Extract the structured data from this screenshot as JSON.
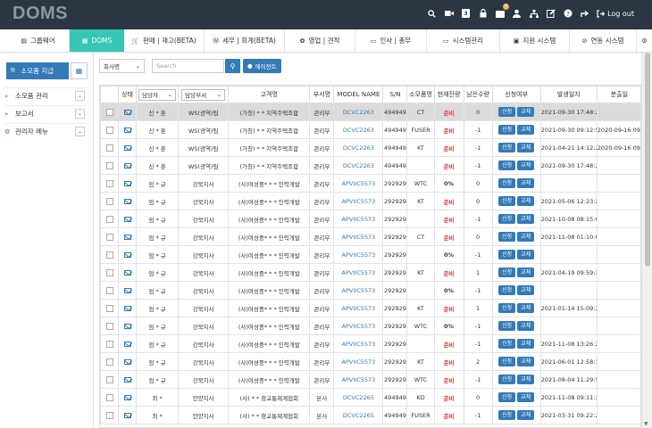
{
  "app": {
    "logo": "DOMS",
    "logout_label": "Log out",
    "notification_count": "0",
    "mail_count": "3"
  },
  "nav": {
    "tabs": [
      {
        "icon": "grid-icon",
        "glyph": "▤",
        "label": "그룹웨어"
      },
      {
        "icon": "grid-icon",
        "glyph": "▦",
        "label": "DOMS"
      },
      {
        "icon": "cart-icon",
        "glyph": "🛒",
        "label": "판매 | 재고(BETA)"
      },
      {
        "icon": "won-icon",
        "glyph": "Ⓦ",
        "label": "세무 | 회계(BETA)"
      },
      {
        "icon": "handshake-icon",
        "glyph": "✿",
        "label": "영업 | 견적"
      },
      {
        "icon": "person-card-icon",
        "glyph": "▭",
        "label": "인사 | 총무"
      },
      {
        "icon": "monitor-icon",
        "glyph": "▭",
        "label": "시스템관리"
      },
      {
        "icon": "briefcase-icon",
        "glyph": "▣",
        "label": "지원 시스템"
      },
      {
        "icon": "link-icon",
        "glyph": "⊘",
        "label": "연동 시스템"
      }
    ]
  },
  "sidebar": {
    "title": "소모품 지급",
    "items": [
      {
        "label": "소모품 관리"
      },
      {
        "label": "보고서"
      },
      {
        "label": "관리자 메뉴"
      }
    ]
  },
  "filter": {
    "select_value": "회사명",
    "search_placeholder": "Search",
    "agent_button": "에이전트"
  },
  "table": {
    "headers": {
      "status": "상태",
      "manager_select": "담당자",
      "dept_select": "담당부서",
      "customer": "고객명",
      "dept": "부서명",
      "model": "MODEL NAME",
      "sn": "S/N",
      "item": "소모품명",
      "toner": "현재잔량",
      "remain": "남은수량",
      "apply_status": "신청여부",
      "date": "발생일지",
      "split": "분출일"
    },
    "apply_label": "신청",
    "replace_label": "교체",
    "rows": [
      {
        "manager": "신 * 훈",
        "mdept": "WS(광역)팀",
        "customer": "(가칭) * * 지역주택조합",
        "dept": "관리부",
        "model": "DCVC2263",
        "sn": "494949",
        "item": "CT",
        "level": "준비",
        "remain": "0",
        "date": "2021-09-30 17:48:21",
        "split": ""
      },
      {
        "manager": "신 * 훈",
        "mdept": "WS(광역)팀",
        "customer": "(가칭) * * 지역주택조합",
        "dept": "관리부",
        "model": "DCVC2263",
        "sn": "494949",
        "item": "FUSER",
        "level": "준비",
        "remain": "-1",
        "date": "2021-09-30 09:12:51",
        "split": "2020-09-16 09:54"
      },
      {
        "manager": "신 * 훈",
        "mdept": "WS(광역)팀",
        "customer": "(가칭) * * 지역주택조합",
        "dept": "관리부",
        "model": "DCVC2263",
        "sn": "494949",
        "item": "KT",
        "level": "준비",
        "remain": "-1",
        "date": "2021-04-21 14:12:23",
        "split": "2020-09-16 09:54"
      },
      {
        "manager": "신 * 훈",
        "mdept": "WS(광역)팀",
        "customer": "(가칭) * * 지역주택조합",
        "dept": "관리부",
        "model": "DCVC2263",
        "sn": "494949",
        "item": "",
        "level": "준비",
        "remain": "-1",
        "date": "2021-09-30 17:48:21",
        "split": ""
      },
      {
        "manager": "엄 * 규",
        "mdept": "강북지사",
        "customer": "(사)여성중* * * 인력개발",
        "dept": "관리부",
        "model": "APVIIC5573",
        "sn": "292929",
        "item": "WTC",
        "level": "0%",
        "remain": "0",
        "date": "",
        "split": ""
      },
      {
        "manager": "엄 * 규",
        "mdept": "강북지사",
        "customer": "(사)여성중* * * 인력개발",
        "dept": "관리부",
        "model": "APVIIC5573",
        "sn": "292929",
        "item": "KT",
        "level": "준비",
        "remain": "0",
        "date": "2021-05-06 12:23:29",
        "split": ""
      },
      {
        "manager": "엄 * 규",
        "mdept": "강북지사",
        "customer": "(사)여성중* * * 인력개발",
        "dept": "관리부",
        "model": "APVIIC5573",
        "sn": "292929",
        "item": "",
        "level": "준비",
        "remain": "-1",
        "date": "2021-10-08 08:15:02",
        "split": ""
      },
      {
        "manager": "엄 * 규",
        "mdept": "강북지사",
        "customer": "(사)여성중* * * 인력개발",
        "dept": "관리부",
        "model": "APVIIC5573",
        "sn": "292929",
        "item": "CT",
        "level": "준비",
        "remain": "0",
        "date": "2021-11-08 01:10:06",
        "split": ""
      },
      {
        "manager": "엄 * 규",
        "mdept": "강북지사",
        "customer": "(사)여성중* * * 인력개발",
        "dept": "관리부",
        "model": "APVIIC5573",
        "sn": "292929",
        "item": "",
        "level": "0%",
        "remain": "-1",
        "date": "",
        "split": ""
      },
      {
        "manager": "엄 * 규",
        "mdept": "강북지사",
        "customer": "(사)여성중* * * 인력개발",
        "dept": "관리부",
        "model": "APVIIC5573",
        "sn": "292929",
        "item": "KT",
        "level": "준비",
        "remain": "1",
        "date": "2021-04-19 09:59:34",
        "split": ""
      },
      {
        "manager": "엄 * 규",
        "mdept": "강북지사",
        "customer": "(사)여성중* * * 인력개발",
        "dept": "관리부",
        "model": "APVIIC5573",
        "sn": "292929",
        "item": "",
        "level": "0%",
        "remain": "-1",
        "date": "",
        "split": ""
      },
      {
        "manager": "엄 * 규",
        "mdept": "강북지사",
        "customer": "(사)여성중* * * 인력개발",
        "dept": "관리부",
        "model": "APVIIC5573",
        "sn": "292929",
        "item": "KT",
        "level": "준비",
        "remain": "1",
        "date": "2021-01-14 15:09:21",
        "split": ""
      },
      {
        "manager": "엄 * 규",
        "mdept": "강북지사",
        "customer": "(사)여성중* * * 인력개발",
        "dept": "관리부",
        "model": "APVIIC5573",
        "sn": "292929",
        "item": "WTC",
        "level": "0%",
        "remain": "-1",
        "date": "",
        "split": ""
      },
      {
        "manager": "엄 * 규",
        "mdept": "강북지사",
        "customer": "(사)여성중* * * 인력개발",
        "dept": "관리부",
        "model": "APVIIC5573",
        "sn": "292929",
        "item": "",
        "level": "준비",
        "remain": "-1",
        "date": "2021-11-08 13:26:27",
        "split": ""
      },
      {
        "manager": "엄 * 규",
        "mdept": "강북지사",
        "customer": "(사)여성중* * * 인력개발",
        "dept": "관리부",
        "model": "APVIIC5573",
        "sn": "292929",
        "item": "KT",
        "level": "준비",
        "remain": "2",
        "date": "2021-06-01 12:58:13",
        "split": ""
      },
      {
        "manager": "엄 * 규",
        "mdept": "강북지사",
        "customer": "(사)여성중* * * 인력개발",
        "dept": "관리부",
        "model": "APVIIC5573",
        "sn": "292929",
        "item": "WTC",
        "level": "준비",
        "remain": "-1",
        "date": "2021-08-04 11:29:55",
        "split": ""
      },
      {
        "manager": "최 *",
        "mdept": "안양지사",
        "customer": "(사) * * 항교통제계협회",
        "dept": "본사",
        "model": "DCVC2265",
        "sn": "494949",
        "item": "KD",
        "level": "준비",
        "remain": "0",
        "date": "2021-11-08 09:11:33",
        "split": ""
      },
      {
        "manager": "최 *",
        "mdept": "안양지사",
        "customer": "(사) * * 항교통제계협회",
        "dept": "본사",
        "model": "DCVC2265",
        "sn": "494949",
        "item": "FUSER",
        "level": "준비",
        "remain": "-1",
        "date": "2021-03-31 09:22:23",
        "split": ""
      }
    ]
  },
  "colors": {
    "topbar": "#2b3643",
    "accent": "#337ab7",
    "active_tab": "#36c6b4",
    "status_red": "#e53935"
  }
}
